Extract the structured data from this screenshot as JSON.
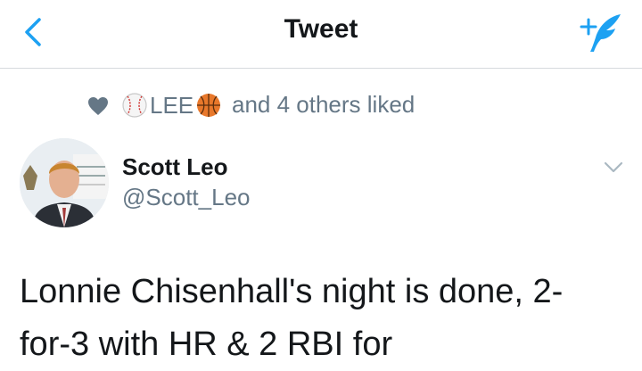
{
  "nav": {
    "title": "Tweet"
  },
  "social_context": {
    "liker_name": "LEE",
    "liked_text": "and 4 others liked"
  },
  "tweet": {
    "author_name": "Scott Leo",
    "author_handle": "@Scott_Leo",
    "text_line_1": "Lonnie Chisenhall's night is done, 2-",
    "text_line_2": "for-3 with HR & 2 RBI for"
  },
  "icons": {
    "back": "chevron-left-icon",
    "compose": "compose-tweet-icon",
    "heart": "heart-icon",
    "baseball": "baseball-emoji",
    "basketball": "basketball-emoji",
    "menu": "chevron-down-icon"
  },
  "colors": {
    "accent": "#1da1f2",
    "muted": "#657786",
    "text": "#14171a",
    "heart": "#657786"
  }
}
